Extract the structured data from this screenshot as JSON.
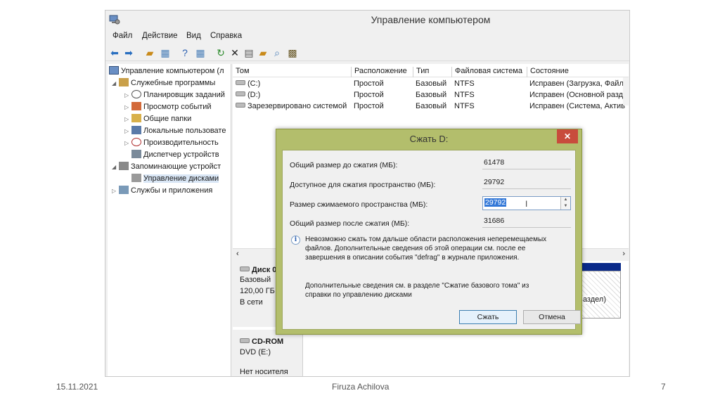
{
  "window": {
    "title": "Управление компьютером"
  },
  "menu": [
    "Файл",
    "Действие",
    "Вид",
    "Справка"
  ],
  "tree": {
    "root": "Управление компьютером (л",
    "items": [
      {
        "label": "Служебные программы",
        "level": 1,
        "expanded": true
      },
      {
        "label": "Планировщик заданий",
        "level": 2
      },
      {
        "label": "Просмотр событий",
        "level": 2
      },
      {
        "label": "Общие папки",
        "level": 2
      },
      {
        "label": "Локальные пользовате",
        "level": 2
      },
      {
        "label": "Производительность",
        "level": 2
      },
      {
        "label": "Диспетчер устройств",
        "level": 2
      },
      {
        "label": "Запоминающие устройст",
        "level": 1,
        "expanded": true
      },
      {
        "label": "Управление дисками",
        "level": 2,
        "selected": true
      },
      {
        "label": "Службы и приложения",
        "level": 1
      }
    ]
  },
  "volumes": {
    "headers": [
      "Том",
      "Расположение",
      "Тип",
      "Файловая система",
      "Состояние"
    ],
    "rows": [
      [
        "(C:)",
        "Простой",
        "Базовый",
        "NTFS",
        "Исправен (Загрузка, Файл"
      ],
      [
        "(D:)",
        "Простой",
        "Базовый",
        "NTFS",
        "Исправен (Основной разд"
      ],
      [
        "Зарезервировано системой",
        "Простой",
        "Базовый",
        "NTFS",
        "Исправен (Система, Актив"
      ]
    ]
  },
  "disks": {
    "disk0": {
      "name": "Диск 0",
      "type": "Базовый",
      "size": "120,00 ГБ",
      "status": "В сети",
      "partial_label": "аздел)"
    },
    "cdrom": {
      "name": "CD-ROM",
      "drive": "DVD (E:)",
      "status": "Нет носителя"
    }
  },
  "dialog": {
    "title": "Сжать D:",
    "close_label": "✕",
    "rows": [
      {
        "label": "Общий размер до сжатия (МБ):",
        "value": "61478"
      },
      {
        "label": "Доступное для сжатия пространство (МБ):",
        "value": "29792"
      },
      {
        "label": "Размер сжимаемого пространства (МБ):",
        "value": "29792"
      },
      {
        "label": "Общий размер после сжатия (МБ):",
        "value": "31686"
      }
    ],
    "info_text": [
      "Невозможно сжать том дальше области расположения неперемещаемых",
      "файлов. Дополнительные сведения об этой операции см. после ее",
      "завершения в описании события \"defrag\" в журнале приложения."
    ],
    "help_text": [
      "Дополнительные сведения см. в разделе \"Сжатие базового тома\" из",
      "справки по управлению дисками"
    ],
    "ok_label": "Сжать",
    "cancel_label": "Отмена"
  },
  "footer": {
    "date": "15.11.2021",
    "author": "Firuza Achilova",
    "page": "7"
  },
  "colors": {
    "dialog_frame": "#b3be6c",
    "close_button": "#c84c3c",
    "selection": "#3378d8"
  }
}
